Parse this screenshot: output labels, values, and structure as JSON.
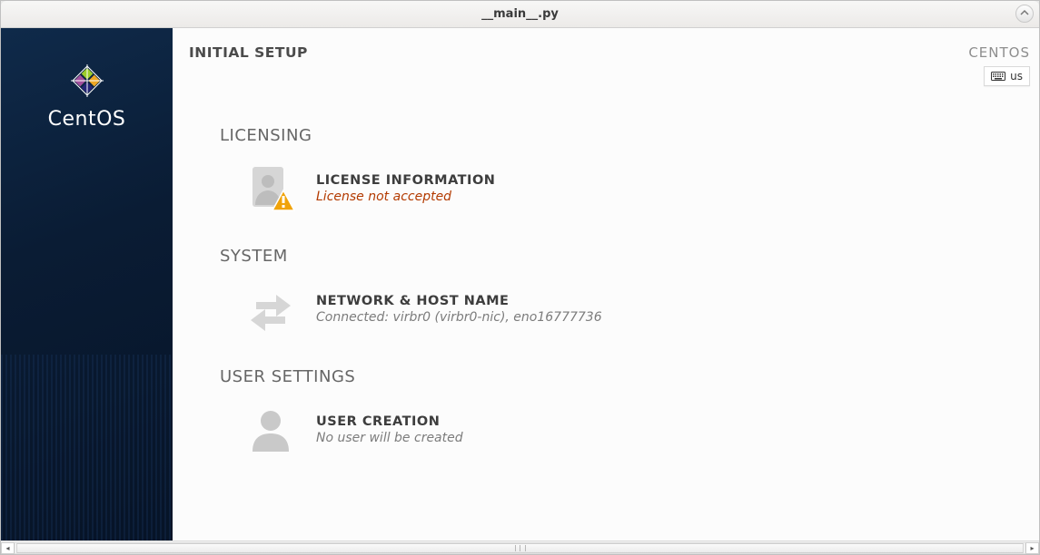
{
  "window": {
    "title": "__main__.py"
  },
  "sidebar": {
    "brand": "CentOS"
  },
  "header": {
    "page_title": "INITIAL SETUP",
    "distribution": "CENTOS",
    "keyboard_layout": "us"
  },
  "sections": {
    "licensing": {
      "heading": "LICENSING",
      "license_info": {
        "title": "LICENSE INFORMATION",
        "status": "License not accepted",
        "status_type": "warn"
      }
    },
    "system": {
      "heading": "SYSTEM",
      "network": {
        "title": "NETWORK & HOST NAME",
        "status": "Connected: virbr0 (virbr0-nic), eno16777736"
      }
    },
    "user_settings": {
      "heading": "USER SETTINGS",
      "user_creation": {
        "title": "USER CREATION",
        "status": "No user will be created"
      }
    }
  },
  "icons": {
    "license": "document-warning-icon",
    "network": "network-arrows-icon",
    "user": "user-silhouette-icon",
    "keyboard": "keyboard-icon",
    "window_max": "window-maximize-icon"
  }
}
